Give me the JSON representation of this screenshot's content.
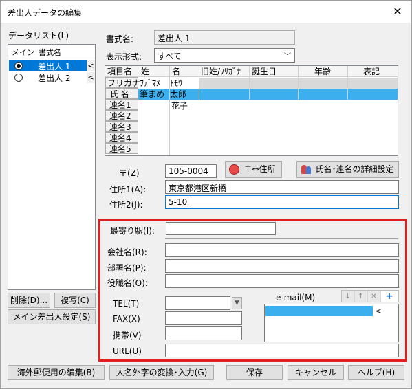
{
  "window": {
    "title": "差出人データの編集",
    "close": "✕"
  },
  "sender_list": {
    "label": "データリスト(L)",
    "col_main": "メイン",
    "col_name": "書式名",
    "items": [
      {
        "name": "差出人 1",
        "selected": true
      },
      {
        "name": "差出人 2",
        "selected": false
      }
    ],
    "arrow": "<"
  },
  "left_buttons": {
    "delete": "削除(D)...",
    "copy": "複写(C)",
    "set_main": "メイン差出人設定(S)"
  },
  "form": {
    "format_name_label": "書式名:",
    "format_name_value": "差出人 1",
    "display_label": "表示形式:",
    "display_value": "すべて"
  },
  "grid": {
    "headers": [
      "項目名",
      "姓",
      "名",
      "旧姓/ﾌﾘｶﾞﾅ",
      "誕生日",
      "年齢",
      "表記"
    ],
    "row_labels": [
      "フリガナ",
      "氏 名",
      "連名1",
      "連名2",
      "連名3",
      "連名4",
      "連名5"
    ],
    "furigana_sei": "ﾌﾃﾞﾏﾒ",
    "furigana_mei": "ﾄﾓｳ",
    "name_sei": "筆まめ",
    "name_mei": "太郎",
    "renmei1_mei": "花子"
  },
  "address": {
    "zip_label": "〒(Z)",
    "zip_value": "105-0004",
    "zip_convert_btn": "〒⇔住所",
    "detail_btn": "氏名･連名の詳細設定",
    "addr1_label": "住所1(A):",
    "addr1_value": "東京都港区新橋",
    "addr2_label": "住所2(J):",
    "addr2_value": "5-10"
  },
  "company": {
    "station_label": "最寄り駅(I):",
    "company_label": "会社名(R):",
    "dept_label": "部署名(P):",
    "title_label": "役職名(O):",
    "tel_label": "TEL(T)",
    "fax_label": "FAX(X)",
    "mobile_label": "携帯(V)",
    "url_label": "URL(U)",
    "email_label": "e-mail(M)"
  },
  "bottom_buttons": {
    "intl": "海外郵便用の編集(B)",
    "gaiji": "人名外字の変換･入力(G)",
    "save": "保存",
    "cancel": "キャンセル",
    "help": "ヘルプ(H)"
  },
  "colors": {
    "selection": "#0078d7",
    "grid_selection": "#3cb0ee",
    "highlight_box": "#e02020"
  }
}
